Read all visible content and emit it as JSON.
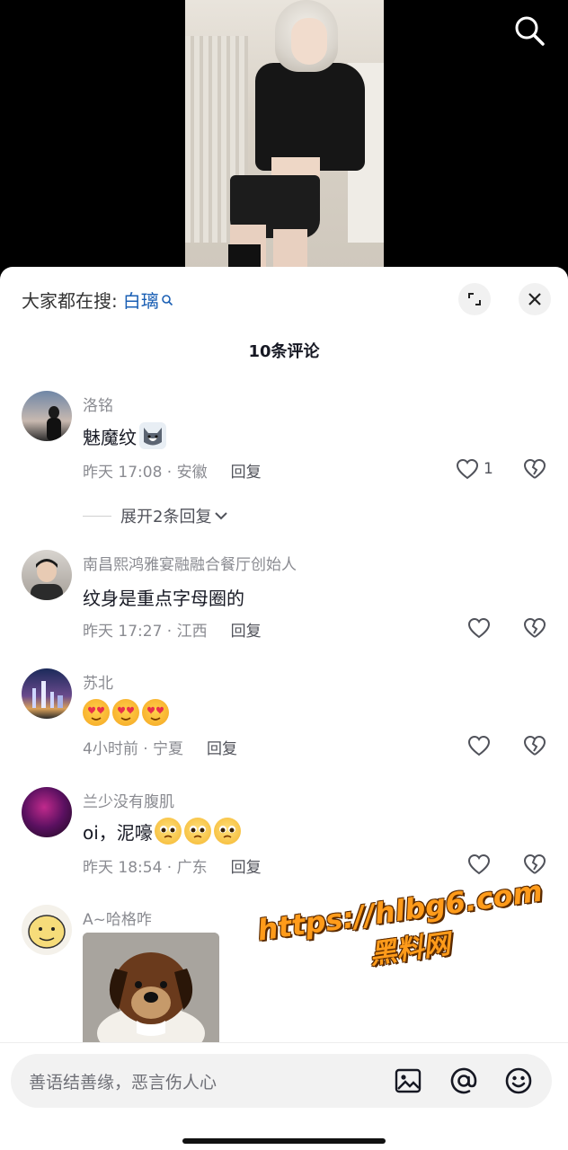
{
  "video": {
    "search_icon": "search-icon"
  },
  "sheet": {
    "hot_search_prefix": "大家都在搜:",
    "hot_search_keyword": "白璃",
    "comment_count": "10条评论",
    "expand_icon": "expand-icon",
    "close_icon": "close-icon"
  },
  "comments": [
    {
      "name": "洛铭",
      "text": "魅魔纹",
      "emoji": "husky-emoji",
      "meta": "昨天 17:08 · 安徽",
      "reply": "回复",
      "likes": "1"
    },
    {
      "name": "南昌熙鸿雅宴融融合餐厅创始人",
      "text": "纹身是重点字母圈的",
      "meta": "昨天 17:27 · 江西",
      "reply": "回复"
    },
    {
      "name": "苏北",
      "text": "",
      "emoji": "heart-eyes-emoji",
      "meta": "4小时前 · 宁夏",
      "reply": "回复"
    },
    {
      "name": "兰少没有腹肌",
      "text": "oi，泥嚎",
      "emoji": "pleading-emoji",
      "meta": "昨天 18:54 · 广东",
      "reply": "回复"
    },
    {
      "name": "A~哈格咋",
      "image": "puppy-photo"
    }
  ],
  "expand_replies": "展开2条回复",
  "watermark": {
    "url": "https://hlbg6.com",
    "sub": "黑料网"
  },
  "input": {
    "placeholder": "善语结善缘，恶言伤人心",
    "icons": [
      "image-icon",
      "at-icon",
      "emoji-icon"
    ]
  },
  "colors": {
    "link": "#1a5fb4",
    "meta": "#8a8b91",
    "text": "#161823",
    "watermark": "#ff9b1a"
  }
}
